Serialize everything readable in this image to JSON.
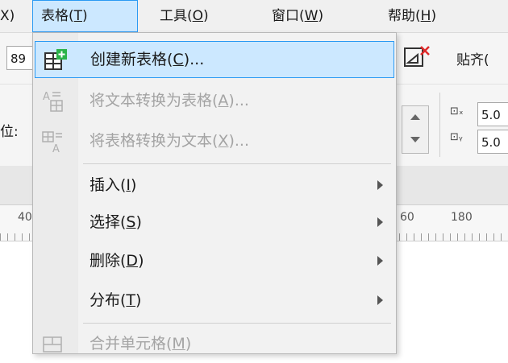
{
  "menubar": {
    "items": [
      {
        "label": "X)",
        "mnemonic": ""
      },
      {
        "label": "表格(",
        "mnemonic": "T",
        "suffix": ")"
      },
      {
        "label": "工具(",
        "mnemonic": "O",
        "suffix": ")"
      },
      {
        "label": "窗口(",
        "mnemonic": "W",
        "suffix": ")"
      },
      {
        "label": "帮助(",
        "mnemonic": "H",
        "suffix": ")"
      }
    ]
  },
  "toolbar": {
    "left_field_value": "89",
    "snap_label": "贴齐(",
    "position_label": "位:",
    "x_value": "5.0",
    "y_value": "5.0"
  },
  "ruler": {
    "labels": [
      "40",
      "60",
      "180"
    ]
  },
  "dropdown": {
    "items": [
      {
        "label": "创建新表格(",
        "mnemonic": "C",
        "suffix": ")...",
        "state": "highlighted"
      },
      {
        "label": "将文本转换为表格(",
        "mnemonic": "A",
        "suffix": ")...",
        "state": "disabled"
      },
      {
        "label": "将表格转换为文本(",
        "mnemonic": "X",
        "suffix": ")...",
        "state": "disabled"
      },
      {
        "label": "插入(",
        "mnemonic": "I",
        "suffix": ")",
        "state": "submenu"
      },
      {
        "label": "选择(",
        "mnemonic": "S",
        "suffix": ")",
        "state": "submenu"
      },
      {
        "label": "删除(",
        "mnemonic": "D",
        "suffix": ")",
        "state": "submenu"
      },
      {
        "label": "分布(",
        "mnemonic": "T",
        "suffix": ")",
        "state": "submenu"
      },
      {
        "label": "合并单元格(",
        "mnemonic": "M",
        "suffix": ")",
        "state": "disabled"
      }
    ]
  },
  "colors": {
    "highlight_bg": "#cce8ff",
    "highlight_border": "#2b9af3",
    "disabled_text": "#a4a4a4",
    "accent_green": "#2bb34a",
    "accent_red": "#e02a2a"
  }
}
